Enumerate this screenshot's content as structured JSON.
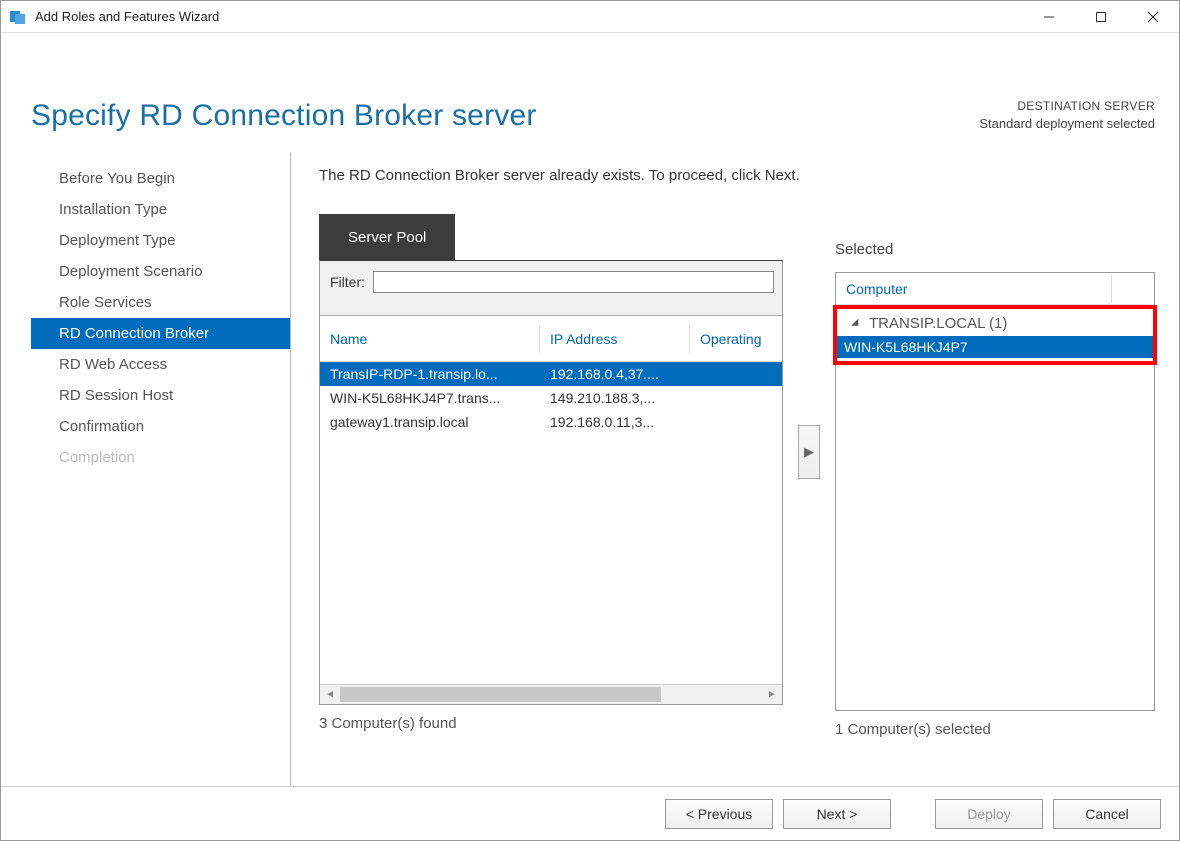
{
  "window": {
    "title": "Add Roles and Features Wizard"
  },
  "header": {
    "page_title": "Specify RD Connection Broker server",
    "dest_label": "DESTINATION SERVER",
    "dest_value": "Standard deployment selected"
  },
  "nav": {
    "items": [
      {
        "label": "Before You Begin",
        "state": "normal"
      },
      {
        "label": "Installation Type",
        "state": "normal"
      },
      {
        "label": "Deployment Type",
        "state": "normal"
      },
      {
        "label": "Deployment Scenario",
        "state": "normal"
      },
      {
        "label": "Role Services",
        "state": "normal"
      },
      {
        "label": "RD Connection Broker",
        "state": "active"
      },
      {
        "label": "RD Web Access",
        "state": "normal"
      },
      {
        "label": "RD Session Host",
        "state": "normal"
      },
      {
        "label": "Confirmation",
        "state": "normal"
      },
      {
        "label": "Completion",
        "state": "disabled"
      }
    ]
  },
  "content": {
    "instruction": "The RD Connection Broker server already exists. To proceed, click Next.",
    "pool_tab": "Server Pool",
    "filter_label": "Filter:",
    "filter_value": "",
    "grid_headers": {
      "name": "Name",
      "ip": "IP Address",
      "os": "Operating"
    },
    "grid_rows": [
      {
        "name": "TransIP-RDP-1.transip.lo...",
        "ip": "192.168.0.4,37....",
        "selected": true
      },
      {
        "name": "WIN-K5L68HKJ4P7.trans...",
        "ip": "149.210.188.3,...",
        "selected": false
      },
      {
        "name": "gateway1.transip.local",
        "ip": "192.168.0.11,3...",
        "selected": false
      }
    ],
    "pool_count": "3 Computer(s) found",
    "selected_heading": "Selected",
    "selected_col": "Computer",
    "tree_group": "TRANSIP.LOCAL (1)",
    "tree_item": "WIN-K5L68HKJ4P7",
    "selected_count": "1 Computer(s) selected"
  },
  "footer": {
    "previous": "< Previous",
    "next": "Next >",
    "deploy": "Deploy",
    "cancel": "Cancel"
  }
}
